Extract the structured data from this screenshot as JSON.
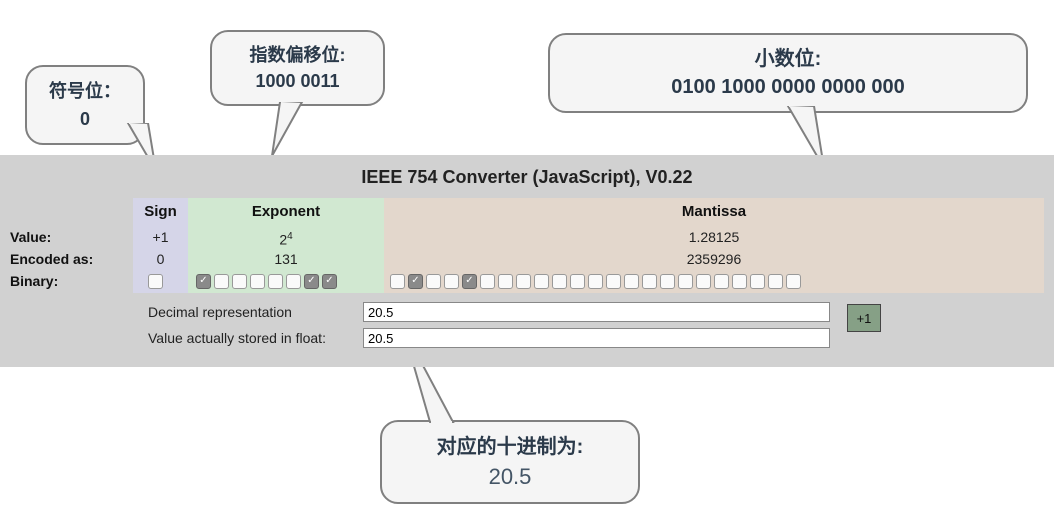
{
  "callouts": {
    "sign": "符号位：0",
    "exponent_label": "指数偏移位:",
    "exponent_bits": "1000 0011",
    "mantissa_label": "小数位:",
    "mantissa_bits": "0100 1000 0000 0000 000",
    "decimal_label": "对应的十进制为:",
    "decimal_value": "20.5"
  },
  "converter": {
    "title": "IEEE 754 Converter (JavaScript), V0.22",
    "row_labels": {
      "value": "Value:",
      "encoded": "Encoded as:",
      "binary": "Binary:"
    },
    "sign": {
      "header": "Sign",
      "value": "+1",
      "encoded": "0",
      "bits": [
        0
      ]
    },
    "exponent": {
      "header": "Exponent",
      "value_base": "2",
      "value_exp": "4",
      "encoded": "131",
      "bits": [
        1,
        0,
        0,
        0,
        0,
        0,
        1,
        1
      ]
    },
    "mantissa": {
      "header": "Mantissa",
      "value": "1.28125",
      "encoded": "2359296",
      "bits": [
        0,
        1,
        0,
        0,
        1,
        0,
        0,
        0,
        0,
        0,
        0,
        0,
        0,
        0,
        0,
        0,
        0,
        0,
        0,
        0,
        0,
        0,
        0
      ]
    },
    "inputs": {
      "decimal_label": "Decimal representation",
      "decimal_value": "20.5",
      "stored_label": "Value actually stored in float:",
      "stored_value": "20.5"
    },
    "plus_button": "+1"
  }
}
